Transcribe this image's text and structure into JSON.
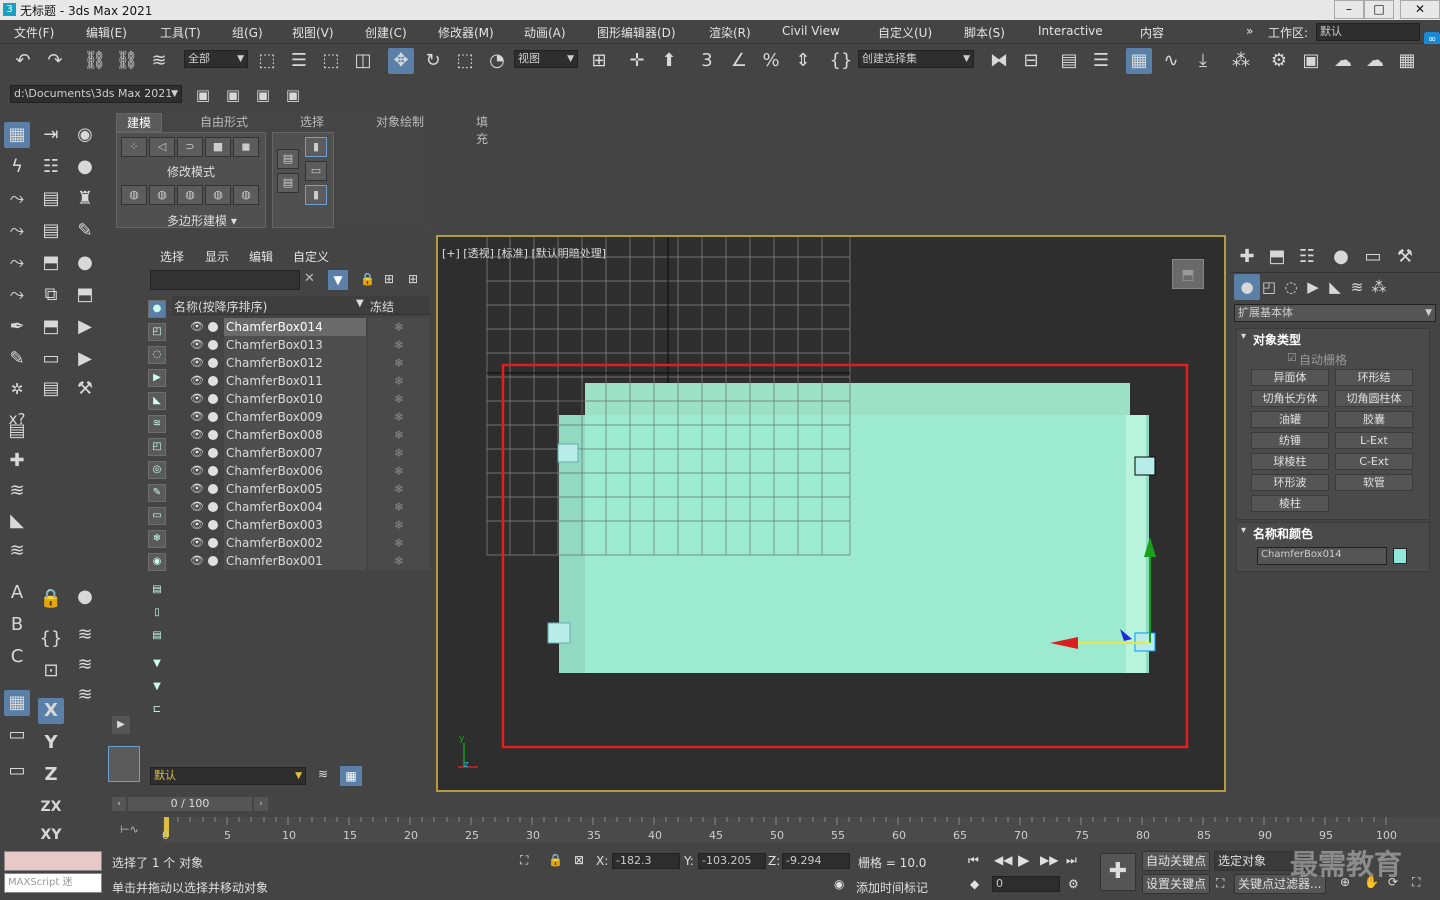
{
  "window": {
    "title": "无标题 - 3ds Max 2021",
    "app_icon": "3"
  },
  "menu": [
    "文件(F)",
    "编辑(E)",
    "工具(T)",
    "组(G)",
    "视图(V)",
    "创建(C)",
    "修改器(M)",
    "动画(A)",
    "图形编辑器(D)",
    "渲染(R)",
    "Civil View",
    "自定义(U)",
    "脚本(S)",
    "Interactive",
    "内容"
  ],
  "workspace": {
    "label": "工作区:",
    "value": "默认"
  },
  "toolbar": {
    "filter_dropdown": "全部",
    "ref_coord_dropdown": "视图",
    "selection_set_dropdown": "创建选择集",
    "project_path": "d:\\Documents\\3ds Max 2021"
  },
  "ribbon": {
    "tabs": [
      "建模",
      "自由形式",
      "选择",
      "对象绘制",
      "填充"
    ],
    "modify_mode_label": "修改模式",
    "poly_modeling_label": "多边形建模 ▾"
  },
  "explorer": {
    "tabs": [
      "选择",
      "显示",
      "编辑",
      "自定义"
    ],
    "col_name": "名称(按降序排序)",
    "col_freeze": "冻结",
    "objects": [
      "ChamferBox014",
      "ChamferBox013",
      "ChamferBox012",
      "ChamferBox011",
      "ChamferBox010",
      "ChamferBox009",
      "ChamferBox008",
      "ChamferBox007",
      "ChamferBox006",
      "ChamferBox005",
      "ChamferBox004",
      "ChamferBox003",
      "ChamferBox002",
      "ChamferBox001"
    ],
    "layer_dropdown": "默认"
  },
  "viewport": {
    "label": "[+] [透视] [标准] [默认明暗处理]"
  },
  "command_panel": {
    "category_dropdown": "扩展基本体",
    "object_type_title": "对象类型",
    "autogrid_label": "自动栅格",
    "buttons": [
      "异面体",
      "环形结",
      "切角长方体",
      "切角圆柱体",
      "油罐",
      "胶囊",
      "纺锤",
      "L-Ext",
      "球棱柱",
      "C-Ext",
      "环形波",
      "软管",
      "棱柱"
    ],
    "name_color_title": "名称和颜色",
    "object_name": "ChamferBox014",
    "object_color": "#8fe8d8"
  },
  "timeline": {
    "frame_display": "0 / 100",
    "ticks": [
      "0",
      "5",
      "10",
      "15",
      "20",
      "25",
      "30",
      "35",
      "40",
      "45",
      "50",
      "55",
      "60",
      "65",
      "70",
      "75",
      "80",
      "85",
      "90",
      "95",
      "100"
    ]
  },
  "status": {
    "maxscript_label": "MAXScript 迷",
    "selected_text": "选择了 1 个 对象",
    "hint_text": "单击并拖动以选择并移动对象",
    "x_label": "X:",
    "x_value": "-182.3",
    "y_label": "Y:",
    "y_value": "-103.205",
    "z_label": "Z:",
    "z_value": "-9.294",
    "grid_text": "栅格 = 10.0",
    "add_time_tag": "添加时间标记",
    "frame_field": "0",
    "auto_key": "自动关键点",
    "selected_obj": "选定对象",
    "set_key": "设置关键点",
    "key_filter": "关键点过滤器...",
    "watermark": "最需教育"
  },
  "colors": {
    "object": "#9cecd0",
    "selection_rect": "#e02020",
    "viewport_border": "#b39b40"
  }
}
